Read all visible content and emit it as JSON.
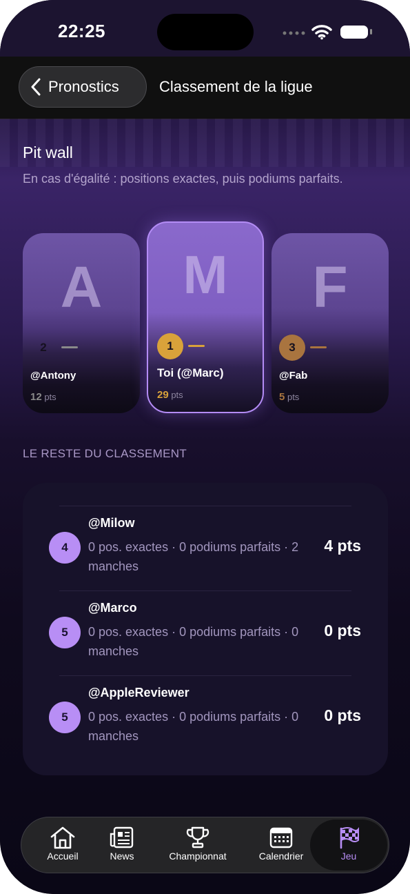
{
  "status": {
    "time": "22:25"
  },
  "nav": {
    "back_label": "Pronostics",
    "title": "Classement de la ligue"
  },
  "league": {
    "name": "Pit wall",
    "tie_note": "En cas d'égalité : positions exactes, puis podiums parfaits."
  },
  "podium": [
    {
      "letter": "A",
      "rank": "2",
      "name": "@Antony",
      "points": "12",
      "unit": "pts",
      "medal_color": "#8a8a8a"
    },
    {
      "letter": "M",
      "rank": "1",
      "name": "Toi (@Marc)",
      "points": "29",
      "unit": "pts",
      "medal_color": "#d9a23a"
    },
    {
      "letter": "F",
      "rank": "3",
      "name": "@Fab",
      "points": "5",
      "unit": "pts",
      "medal_color": "#a9743f"
    }
  ],
  "rest": {
    "title": "LE RESTE DU CLASSEMENT",
    "rows": [
      {
        "rank": "4",
        "name": "@Milow",
        "stats": "0 pos. exactes · 0 podiums parfaits · 2 manches",
        "points": "4 pts"
      },
      {
        "rank": "5",
        "name": "@Marco",
        "stats": "0 pos. exactes · 0 podiums parfaits · 0 manches",
        "points": "0 pts"
      },
      {
        "rank": "5",
        "name": "@AppleReviewer",
        "stats": "0 pos. exactes · 0 podiums parfaits · 0 manches",
        "points": "0 pts"
      }
    ]
  },
  "tabs": [
    {
      "label": "Accueil",
      "icon": "house-icon"
    },
    {
      "label": "News",
      "icon": "newspaper-icon"
    },
    {
      "label": "Championnat",
      "icon": "trophy-icon"
    },
    {
      "label": "Calendrier",
      "icon": "calendar-icon"
    },
    {
      "label": "Jeu",
      "icon": "checkered-flag-icon",
      "active": true
    }
  ],
  "colors": {
    "accent": "#b88ef5",
    "gold": "#d9a23a",
    "silver": "#8a8a8a",
    "bronze": "#a9743f"
  }
}
